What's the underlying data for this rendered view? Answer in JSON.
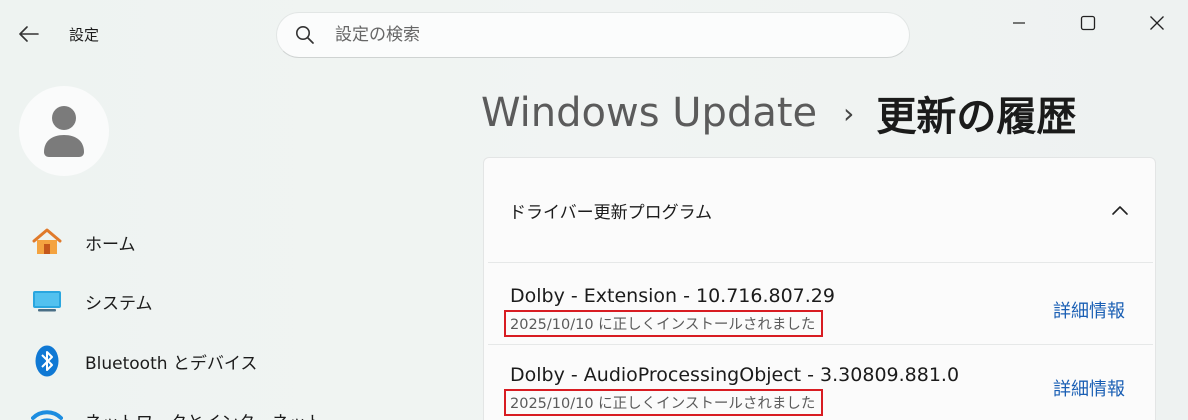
{
  "window": {
    "app_title": "設定"
  },
  "search": {
    "placeholder": "設定の検索"
  },
  "sidebar": {
    "items": [
      {
        "label": "ホーム",
        "icon": "home-icon"
      },
      {
        "label": "システム",
        "icon": "system-icon"
      },
      {
        "label": "Bluetooth とデバイス",
        "icon": "bluetooth-icon"
      },
      {
        "label": "ネットワークとインターネット",
        "icon": "wifi-icon"
      }
    ]
  },
  "breadcrumb": {
    "parent": "Windows Update",
    "separator": "›",
    "current": "更新の履歴"
  },
  "section": {
    "title": "ドライバー更新プログラム",
    "entries": [
      {
        "name": "Dolby - Extension - 10.716.807.29",
        "status": "2025/10/10 に正しくインストールされました",
        "details_label": "詳細情報"
      },
      {
        "name": "Dolby - AudioProcessingObject - 3.30809.881.0",
        "status": "2025/10/10 に正しくインストールされました",
        "details_label": "詳細情報"
      }
    ]
  },
  "colors": {
    "accent": "#1a5fb4",
    "highlight_box": "#d81c22"
  }
}
